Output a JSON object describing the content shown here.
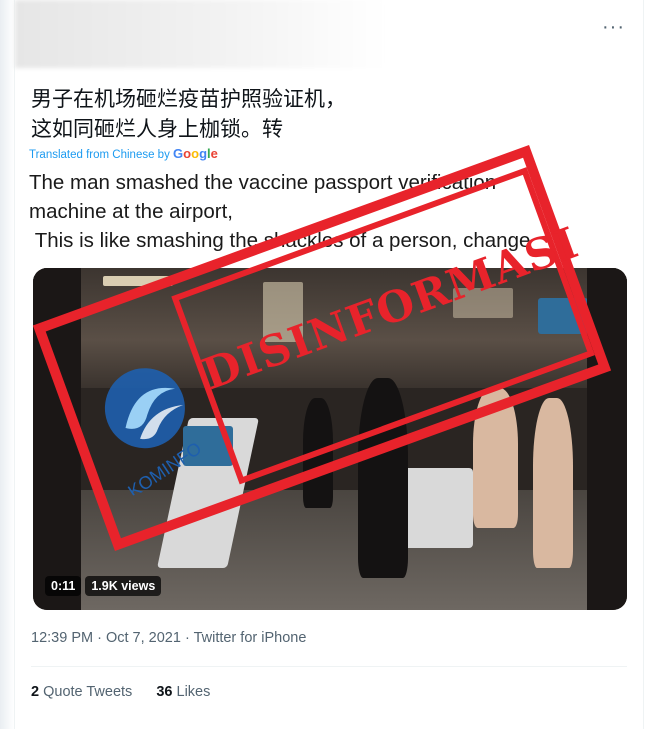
{
  "header": {
    "more_label": "···"
  },
  "tweet": {
    "text_zh_line1": "男子在机场砸烂疫苗护照验证机，",
    "text_zh_line2": "这如同砸烂人身上枷锁。转",
    "translated_from": "Translated from Chinese by ",
    "google_letters": [
      "G",
      "o",
      "o",
      "g",
      "l",
      "e"
    ],
    "text_en": "The man smashed the vaccine passport verification\nmachine at the airport,\n This is like smashing the shackles of a person, change"
  },
  "overlay": {
    "stamp_text": "DISINFORMASI",
    "logo_text": "KOMINFO",
    "stamp_color": "#e8232b",
    "logo_color": "#1e5fae"
  },
  "video": {
    "duration": "0:11",
    "views": "1.9K views"
  },
  "meta": {
    "time": "12:39 PM",
    "sep1": " · ",
    "date": "Oct 7, 2021",
    "sep2": " · ",
    "source": "Twitter for iPhone"
  },
  "stats": {
    "quote_count": "2",
    "quote_label": " Quote Tweets",
    "like_count": "36",
    "like_label": " Likes"
  }
}
